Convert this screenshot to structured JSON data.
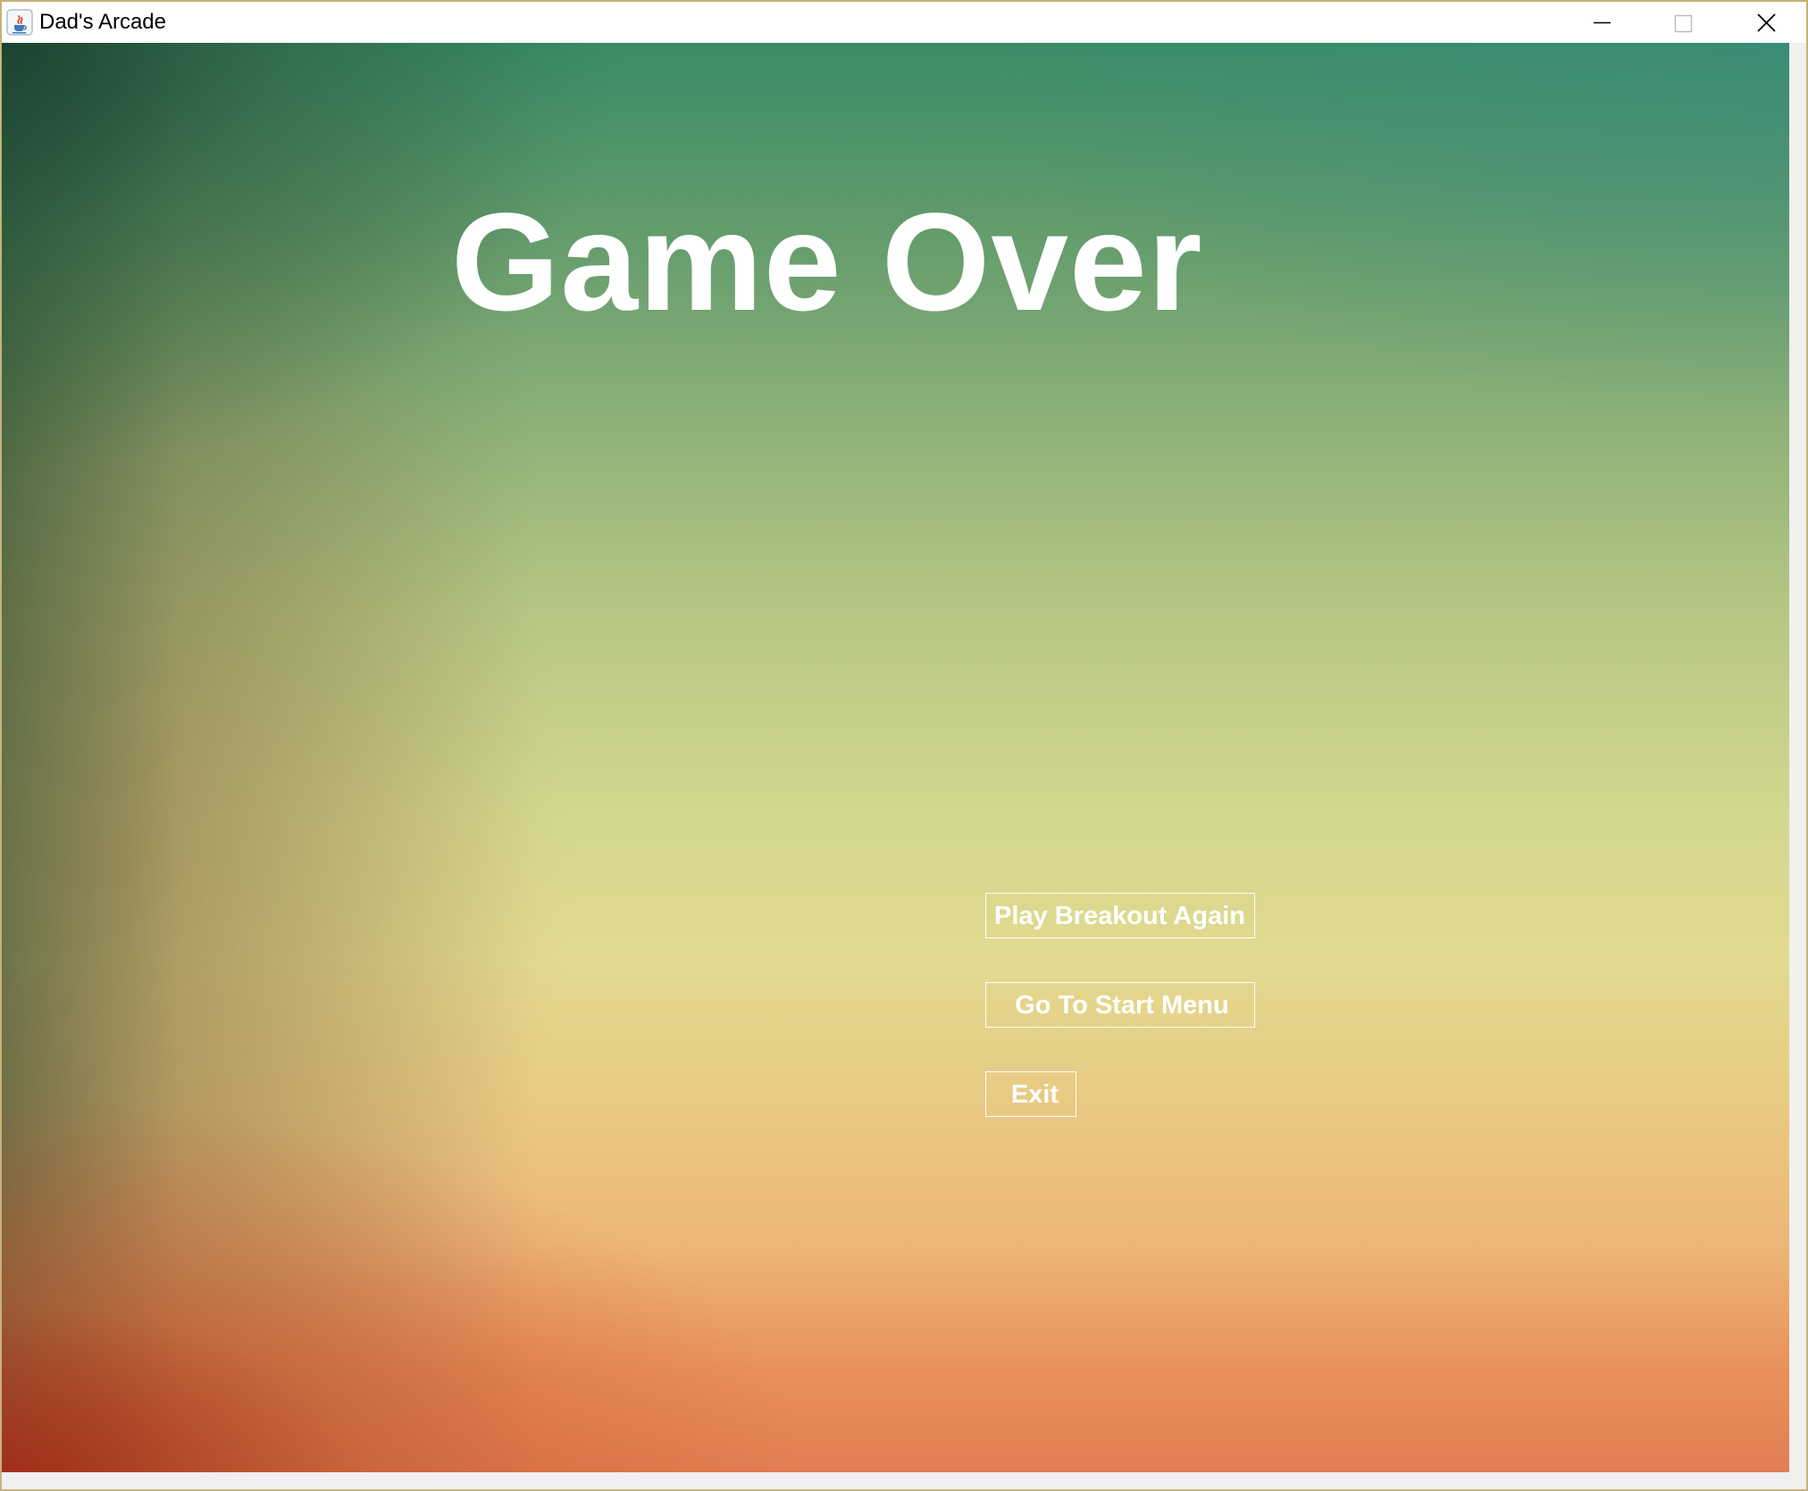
{
  "window": {
    "title": "Dad's Arcade",
    "icon": "java-cup-icon",
    "controls": {
      "minimize": "minimize-icon",
      "maximize": "maximize-icon",
      "close": "close-icon"
    }
  },
  "screen": {
    "heading": "Game Over",
    "buttons": {
      "play_again": "Play Breakout Again",
      "start_menu": "Go To Start Menu",
      "exit": "Exit"
    }
  },
  "colors": {
    "text": "#ffffff",
    "top_green": "#3a8c66",
    "middle_yellow": "#e1da8f",
    "bottom_orange": "#e27e52"
  }
}
